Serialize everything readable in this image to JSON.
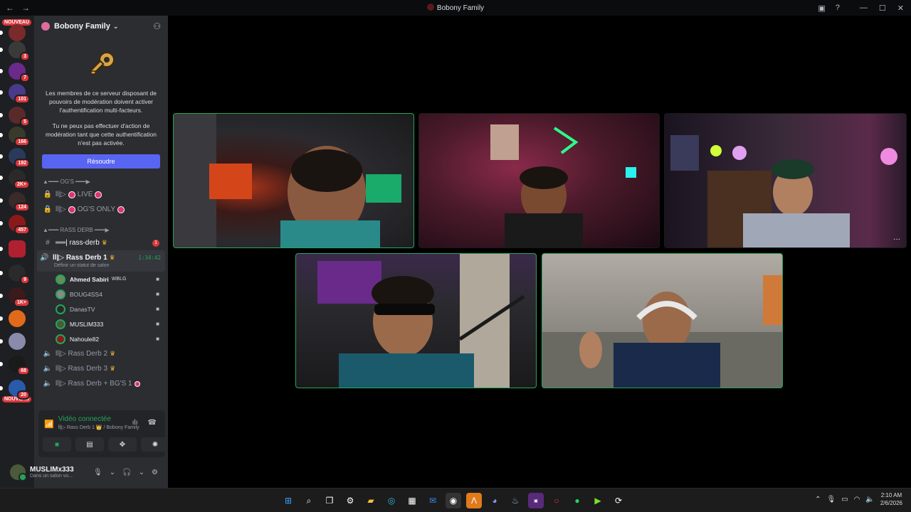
{
  "window": {
    "title": "Bobony Family",
    "back": "←",
    "forward": "→"
  },
  "server_rail": [
    {
      "badge": "",
      "color": "#7a2a2a"
    },
    {
      "badge": "3",
      "color": "#3a3a3a"
    },
    {
      "badge": "7",
      "color": "#6a2a8a"
    },
    {
      "badge": "101",
      "color": "#4a3a8a"
    },
    {
      "badge": "5",
      "color": "#5a2a2a"
    },
    {
      "badge": "166",
      "color": "#3a3a2a"
    },
    {
      "badge": "192",
      "color": "#2a3a5a"
    },
    {
      "badge": "2K+",
      "color": "#2a2a2a"
    },
    {
      "badge": "124",
      "color": "#3a2a2a"
    },
    {
      "badge": "457",
      "color": "#8a1a1a"
    },
    {
      "badge": "",
      "color": "#b02030"
    },
    {
      "badge": "9",
      "color": "#2a2a2a"
    },
    {
      "badge": "1K+",
      "color": "#3a1a1a"
    },
    {
      "badge": "",
      "color": "#e06a1a"
    },
    {
      "badge": "",
      "color": "#8a8aaa"
    },
    {
      "badge": "68",
      "color": "#1a1a1a"
    },
    {
      "badge": "20",
      "color": "#2a5aaa"
    }
  ],
  "nouveau_label": "NOUVEAU",
  "guild": {
    "name": "Bobony Family"
  },
  "mfa": {
    "p1": "Les membres de ce serveur disposant de pouvoirs de modération doivent activer l'authentification multi-facteurs.",
    "p2": "Tu ne peux pas effectuer d'action de modération tant que cette authentification n'est pas activée.",
    "button": "Résoudre"
  },
  "categories": {
    "ogs": "▲━━━ OG'S ━━━▶",
    "rass": "▲━━━ RASS DERB ━━━▶"
  },
  "channels": {
    "live": "ll|▷",
    "live_label": "LIVE",
    "ogs_only": "ll|▷",
    "ogs_only_label": "OG'S ONLY",
    "rass_derb_text": "══| rass-derb",
    "rass_derb_unread": "1",
    "voice1": "ll|▷ Rass Derb 1",
    "voice1_time": "1:34:42",
    "voice1_status": "Définir un statut de salon",
    "voice2": "ll|▷ Rass Derb 2",
    "voice3": "ll|▷ Rass Derb 3",
    "voice4": "ll|▷ Rass Derb + BG'S 1"
  },
  "members": [
    {
      "name": "Ahmed Sabiri",
      "tag": "WBLG",
      "color": "#6a8a5a"
    },
    {
      "name": "BOUG4SS4",
      "tag": "",
      "color": "#8a8a8a"
    },
    {
      "name": "DanasTV",
      "tag": "",
      "color": "#2a2a2a"
    },
    {
      "name": "MUSLIM333",
      "tag": "",
      "color": "#4a5a3a"
    },
    {
      "name": "Nahoule82",
      "tag": "",
      "color": "#8a1a1a"
    }
  ],
  "rtc": {
    "status": "Vidéo connectée",
    "location": "ll|▷ Rass Derb 1 👑 / Bobony Family"
  },
  "user": {
    "name": "MUSLIMx333",
    "status": "Dans un salon vo..."
  },
  "taskbar": {
    "time": "2:10 AM",
    "date": "2/6/2026"
  },
  "tile_menu": "···"
}
